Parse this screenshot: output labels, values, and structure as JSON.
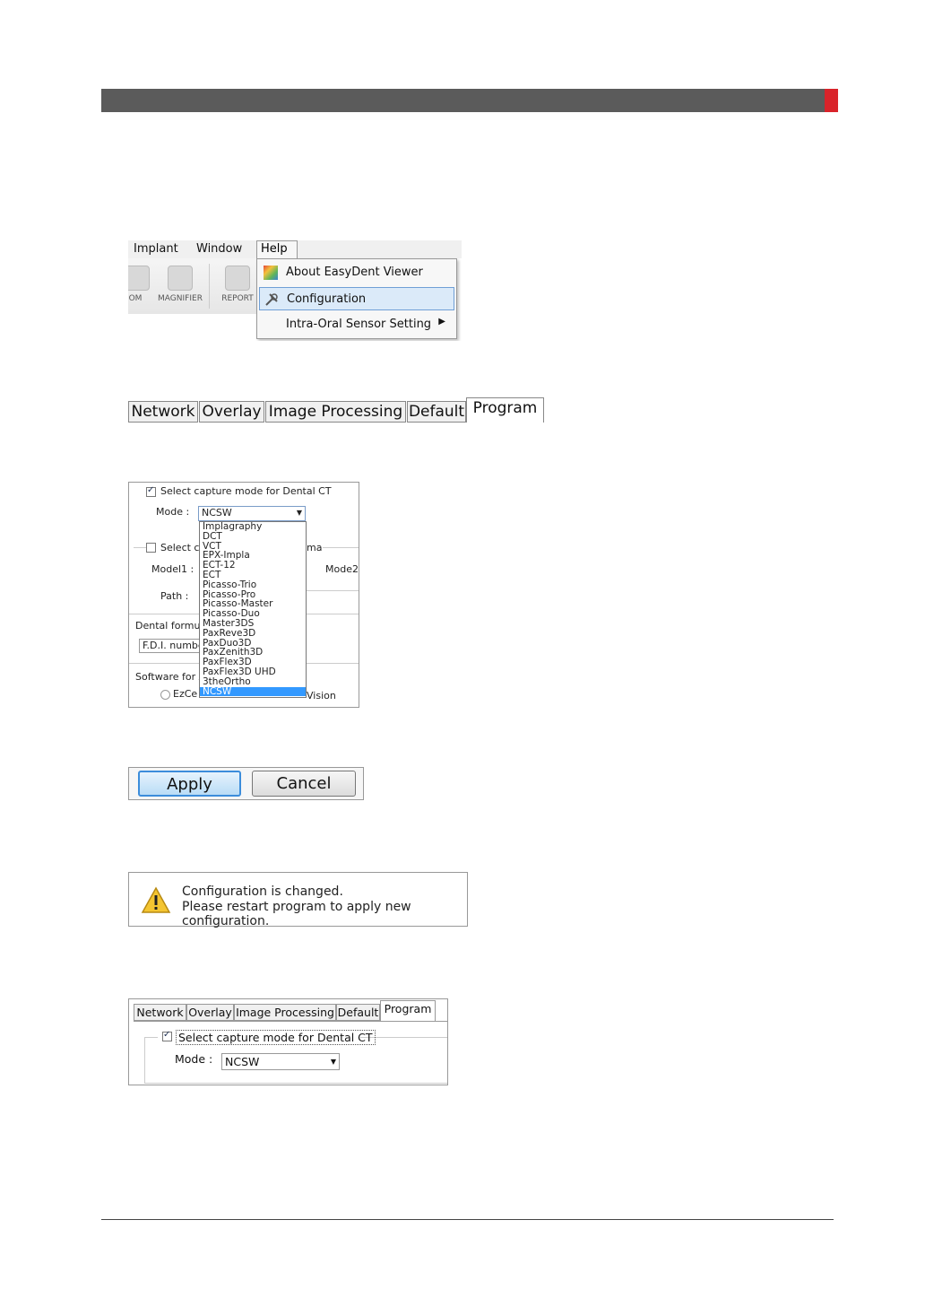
{
  "menu_screenshot": {
    "menubar": [
      "Implant",
      "Window",
      "Help"
    ],
    "toolbar": [
      "OM",
      "MAGNIFIER",
      "REPORT"
    ],
    "menu_items": [
      "About EasyDent Viewer",
      "Configuration",
      "Intra-Oral Sensor Setting"
    ]
  },
  "config_tabs": [
    "Network",
    "Overlay",
    "Image Processing",
    "Default",
    "Program"
  ],
  "dropdown_screenshot": {
    "checkbox_label": "Select capture mode for Dental CT",
    "mode_label": "Mode :",
    "mode_value": "NCSW",
    "select2_label": "Select c",
    "select2_suffix": "ma",
    "model1_label": "Model1 :",
    "mode2_label": "Mode2",
    "path_label": "Path :",
    "dental_formula_label": "Dental formula",
    "fdi_value": "F.D.I. numbe",
    "software_label": "Software for A",
    "ezce_label": "EzCe",
    "vision_label": "Vision",
    "options": [
      "Implagraphy",
      "DCT",
      "VCT",
      "EPX-Impla",
      "ECT-12",
      "ECT",
      "Picasso-Trio",
      "Picasso-Pro",
      "Picasso-Master",
      "Picasso-Duo",
      "Master3DS",
      "PaxReve3D",
      "PaxDuo3D",
      "PaxZenith3D",
      "PaxFlex3D",
      "PaxFlex3D UHD",
      "3theOrtho",
      "NCSW"
    ]
  },
  "buttons": {
    "apply": "Apply",
    "cancel": "Cancel"
  },
  "message": {
    "line1": "Configuration is changed.",
    "line2": "Please restart program to apply new configuration."
  },
  "final_screenshot": {
    "tabs": [
      "Network",
      "Overlay",
      "Image Processing",
      "Default",
      "Program"
    ],
    "checkbox_label": "Select capture mode for Dental CT",
    "mode_label": "Mode :",
    "mode_value": "NCSW"
  }
}
